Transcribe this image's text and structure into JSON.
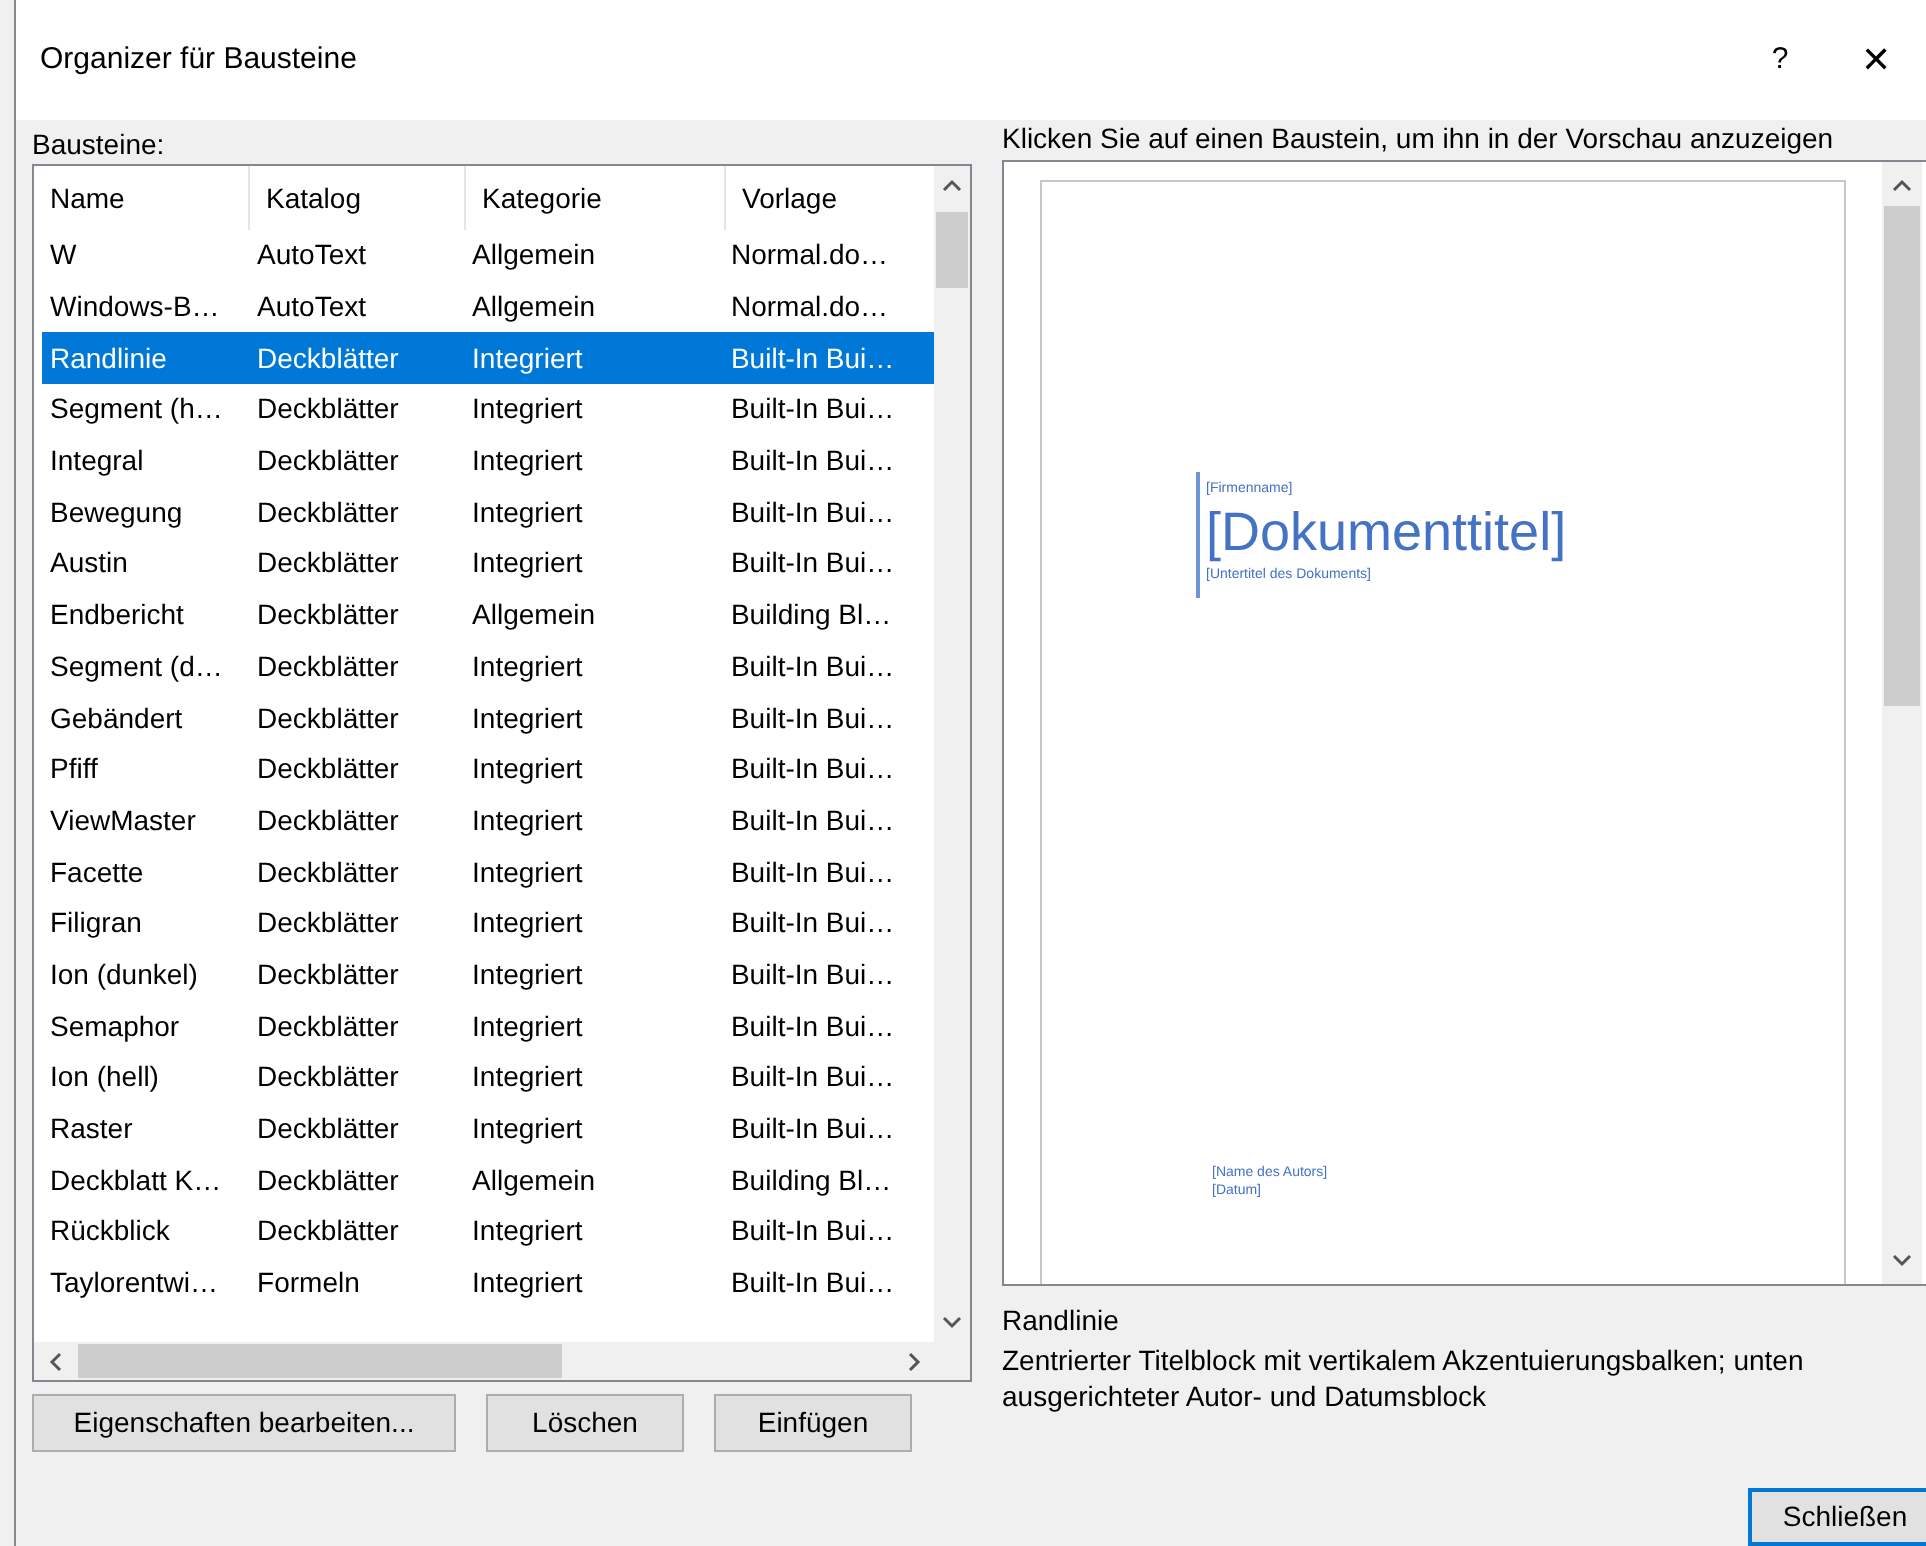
{
  "window": {
    "title": "Organizer für Bausteine",
    "help": "?",
    "close": "✕"
  },
  "list": {
    "label": "Bausteine:",
    "columns": [
      "Name",
      "Katalog",
      "Kategorie",
      "Vorlage"
    ],
    "rows": [
      {
        "cells": [
          "W",
          "AutoText",
          "Allgemein",
          "Normal.do…"
        ],
        "selected": false
      },
      {
        "cells": [
          "Windows-B…",
          "AutoText",
          "Allgemein",
          "Normal.do…"
        ],
        "selected": false
      },
      {
        "cells": [
          "Randlinie",
          "Deckblätter",
          "Integriert",
          "Built-In Bui…"
        ],
        "selected": true
      },
      {
        "cells": [
          "Segment (h…",
          "Deckblätter",
          "Integriert",
          "Built-In Bui…"
        ],
        "selected": false
      },
      {
        "cells": [
          "Integral",
          "Deckblätter",
          "Integriert",
          "Built-In Bui…"
        ],
        "selected": false
      },
      {
        "cells": [
          "Bewegung",
          "Deckblätter",
          "Integriert",
          "Built-In Bui…"
        ],
        "selected": false
      },
      {
        "cells": [
          "Austin",
          "Deckblätter",
          "Integriert",
          "Built-In Bui…"
        ],
        "selected": false
      },
      {
        "cells": [
          "Endbericht",
          "Deckblätter",
          "Allgemein",
          "Building Bl…"
        ],
        "selected": false
      },
      {
        "cells": [
          "Segment (d…",
          "Deckblätter",
          "Integriert",
          "Built-In Bui…"
        ],
        "selected": false
      },
      {
        "cells": [
          "Gebändert",
          "Deckblätter",
          "Integriert",
          "Built-In Bui…"
        ],
        "selected": false
      },
      {
        "cells": [
          "Pfiff",
          "Deckblätter",
          "Integriert",
          "Built-In Bui…"
        ],
        "selected": false
      },
      {
        "cells": [
          "ViewMaster",
          "Deckblätter",
          "Integriert",
          "Built-In Bui…"
        ],
        "selected": false
      },
      {
        "cells": [
          "Facette",
          "Deckblätter",
          "Integriert",
          "Built-In Bui…"
        ],
        "selected": false
      },
      {
        "cells": [
          "Filigran",
          "Deckblätter",
          "Integriert",
          "Built-In Bui…"
        ],
        "selected": false
      },
      {
        "cells": [
          "Ion (dunkel)",
          "Deckblätter",
          "Integriert",
          "Built-In Bui…"
        ],
        "selected": false
      },
      {
        "cells": [
          "Semaphor",
          "Deckblätter",
          "Integriert",
          "Built-In Bui…"
        ],
        "selected": false
      },
      {
        "cells": [
          "Ion (hell)",
          "Deckblätter",
          "Integriert",
          "Built-In Bui…"
        ],
        "selected": false
      },
      {
        "cells": [
          "Raster",
          "Deckblätter",
          "Integriert",
          "Built-In Bui…"
        ],
        "selected": false
      },
      {
        "cells": [
          "Deckblatt K…",
          "Deckblätter",
          "Allgemein",
          "Building Bl…"
        ],
        "selected": false
      },
      {
        "cells": [
          "Rückblick",
          "Deckblätter",
          "Integriert",
          "Built-In Bui…"
        ],
        "selected": false
      },
      {
        "cells": [
          "Taylorentwi…",
          "Formeln",
          "Integriert",
          "Built-In Bui…"
        ],
        "selected": false
      }
    ]
  },
  "buttons": [
    "Eigenschaften bearbeiten...",
    "Löschen",
    "Einfügen"
  ],
  "preview": {
    "label": "Klicken Sie auf einen Baustein, um ihn in der Vorschau anzuzeigen",
    "page": {
      "company": "[Firmenname]",
      "title": "[Dokumenttitel]",
      "subtitle": "[Untertitel des Dokuments]",
      "author": "[Name des Autors]",
      "date": "[Datum]"
    },
    "name": "Randlinie",
    "description": "Zentrierter Titelblock mit vertikalem Akzentuierungsbalken; unten ausgerichteter Autor- und Datumsblock"
  },
  "close_button": "Schließen"
}
